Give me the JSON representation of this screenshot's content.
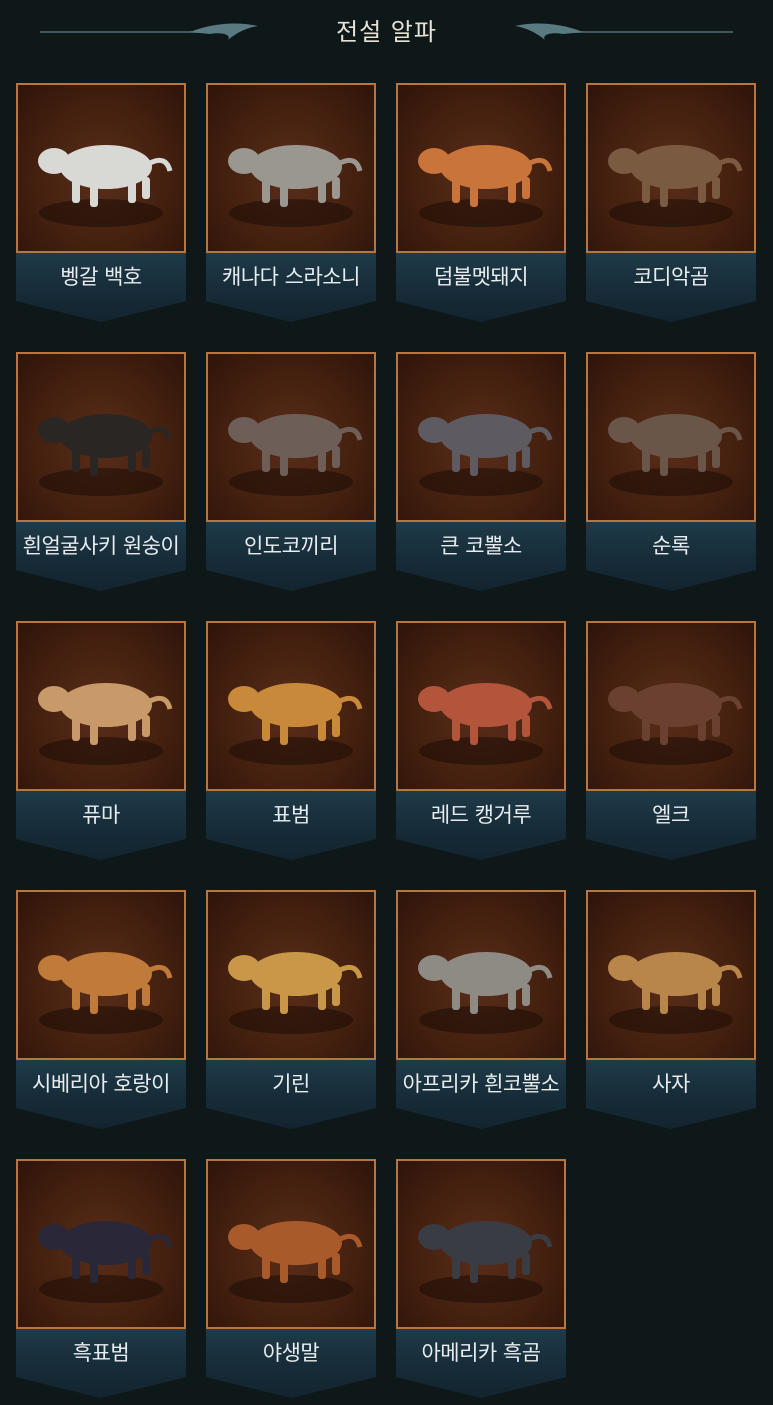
{
  "header": {
    "title": "전설 알파"
  },
  "colors": {
    "background": "#0f1818",
    "card_border": "#b8753d",
    "card_bg": "#44200f",
    "label_bg": "#1a3240",
    "label_text": "#e8ecef"
  },
  "animals": [
    {
      "name": "벵갈 백호",
      "icon": "white-tiger-icon",
      "color": "#d8d8d4"
    },
    {
      "name": "캐나다 스라소니",
      "icon": "lynx-icon",
      "color": "#9a9690"
    },
    {
      "name": "덤불멧돼지",
      "icon": "bushpig-icon",
      "color": "#c8743a"
    },
    {
      "name": "코디악곰",
      "icon": "kodiak-bear-icon",
      "color": "#7a5a40"
    },
    {
      "name": "흰얼굴사키 원숭이",
      "icon": "saki-monkey-icon",
      "color": "#2a2624"
    },
    {
      "name": "인도코끼리",
      "icon": "elephant-icon",
      "color": "#6e5e58"
    },
    {
      "name": "큰 코뿔소",
      "icon": "indian-rhino-icon",
      "color": "#5e5a62"
    },
    {
      "name": "순록",
      "icon": "reindeer-icon",
      "color": "#6a5648"
    },
    {
      "name": "퓨마",
      "icon": "puma-icon",
      "color": "#c89a6a"
    },
    {
      "name": "표범",
      "icon": "leopard-icon",
      "color": "#c88a3a"
    },
    {
      "name": "레드 캥거루",
      "icon": "kangaroo-icon",
      "color": "#b2553a"
    },
    {
      "name": "엘크",
      "icon": "elk-icon",
      "color": "#6a4030"
    },
    {
      "name": "시베리아 호랑이",
      "icon": "siberian-tiger-icon",
      "color": "#c07a3a"
    },
    {
      "name": "기린",
      "icon": "giraffe-icon",
      "color": "#c89848"
    },
    {
      "name": "아프리카 흰코뿔소",
      "icon": "white-rhino-icon",
      "color": "#8e8a84"
    },
    {
      "name": "사자",
      "icon": "lion-icon",
      "color": "#b8864a"
    },
    {
      "name": "흑표범",
      "icon": "black-panther-icon",
      "color": "#2a2838"
    },
    {
      "name": "야생말",
      "icon": "wild-horse-icon",
      "color": "#a85a2a"
    },
    {
      "name": "아메리카 흑곰",
      "icon": "black-bear-icon",
      "color": "#3a3c44"
    }
  ]
}
